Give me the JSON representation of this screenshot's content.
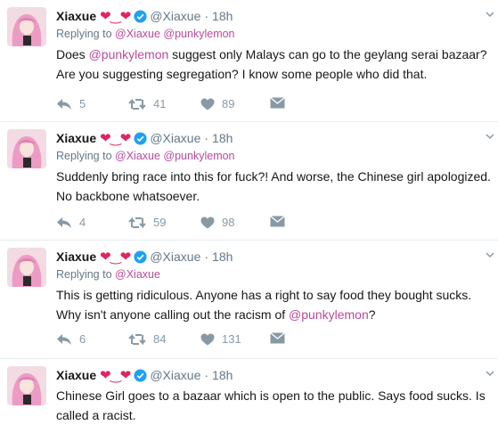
{
  "colors": {
    "mention": "#b84a9c",
    "verified": "#1da1f2",
    "heart": "#e0245e",
    "muted": "#657786",
    "icon": "#8899a6"
  },
  "tweets": [
    {
      "name": "Xiaxue",
      "emoji": "❤‿❤",
      "handle": "@Xiaxue",
      "time": "18h",
      "replying_label": "Replying to",
      "replying_to": "@Xiaxue @punkylemon",
      "line1": {
        "pre": "Does ",
        "mention": "@punkylemon",
        "post": " suggest only Malays can go to the geylang serai bazaar?"
      },
      "line2": "Are you suggesting segregation? I know some people who did that.",
      "reply_count": "5",
      "retweet_count": "41",
      "like_count": "89"
    },
    {
      "name": "Xiaxue",
      "emoji": "❤‿❤",
      "handle": "@Xiaxue",
      "time": "18h",
      "replying_label": "Replying to",
      "replying_to": "@Xiaxue @punkylemon",
      "line1": "Suddenly bring race into this for fuck?! And worse, the Chinese girl apologized.",
      "line2": "No backbone whatsoever.",
      "reply_count": "4",
      "retweet_count": "59",
      "like_count": "98"
    },
    {
      "name": "Xiaxue",
      "emoji": "❤‿❤",
      "handle": "@Xiaxue",
      "time": "18h",
      "replying_label": "Replying to",
      "replying_to": "@Xiaxue",
      "line1": "This is getting ridiculous. Anyone has a right to say food they bought sucks.",
      "line2": {
        "pre": "Why isn't anyone calling out the racism of ",
        "mention": "@punkylemon",
        "post": "?"
      },
      "reply_count": "6",
      "retweet_count": "84",
      "like_count": "131"
    },
    {
      "name": "Xiaxue",
      "emoji": "❤‿❤",
      "handle": "@Xiaxue",
      "time": "18h",
      "line1": "Chinese Girl goes to a bazaar which is open to the public. Says food sucks. Is",
      "line2": "called a racist."
    }
  ],
  "icons": {
    "reply": "reply-icon",
    "retweet": "retweet-icon",
    "like": "heart-icon",
    "dm": "envelope-icon",
    "verified": "verified-badge-icon",
    "caret": "chevron-down-icon"
  }
}
